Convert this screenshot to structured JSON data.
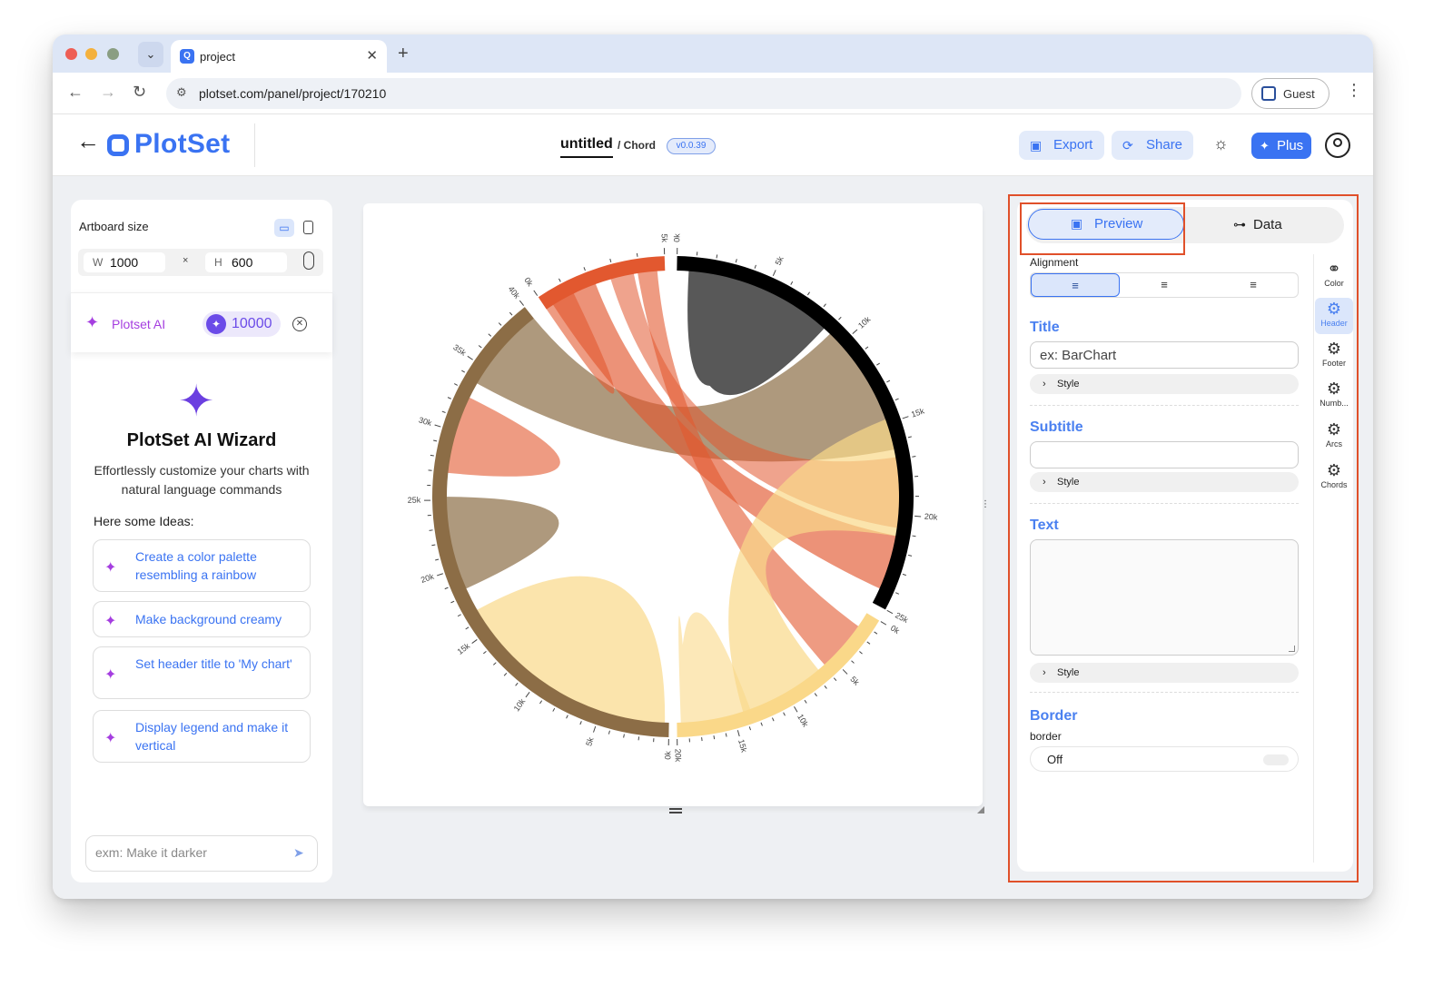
{
  "browser": {
    "tab_title": "project",
    "tab_icon": "plotset-favicon",
    "url": "plotset.com/panel/project/170210",
    "profile_label": "Guest"
  },
  "header": {
    "logo_text": "PlotSet",
    "project_name": "untitled",
    "project_type": "/ Chord",
    "version": "v0.0.39",
    "export_label": "Export",
    "share_label": "Share",
    "plus_label": "Plus"
  },
  "artboard": {
    "title": "Artboard size",
    "w_key": "W",
    "width": "1000",
    "separator": "×",
    "h_key": "H",
    "height": "600"
  },
  "ai": {
    "label": "Plotset AI",
    "credits": "10000",
    "wizard_title": "PlotSet AI Wizard",
    "wizard_subtitle": "Effortlessly customize your charts with natural language commands",
    "ideas_label": "Here some Ideas:",
    "ideas": [
      "Create a color palette resembling a rainbow",
      "Make background creamy",
      "Set header title to 'My chart'",
      "Display legend and make it vertical"
    ],
    "prompt_placeholder": "exm: Make it darker"
  },
  "chart_data": {
    "type": "chord",
    "colors": {
      "black_group": "#000000",
      "brown_group": "#8c6d46",
      "red_group": "#e2582f",
      "yellow_group": "#fad889"
    },
    "groups": [
      {
        "color": "#000000",
        "ticks": [
          "0k",
          "5k",
          "10k",
          "15k",
          "20k",
          "25k"
        ]
      },
      {
        "color": "#fad889",
        "ticks": [
          "0k",
          "5k",
          "10k",
          "15k",
          "20k"
        ]
      },
      {
        "color": "#8c6d46",
        "ticks": [
          "0k",
          "5k",
          "10k",
          "15k",
          "20k",
          "25k",
          "30k",
          "35k",
          "40k"
        ]
      },
      {
        "color": "#e2582f",
        "ticks": [
          "0k",
          "5k"
        ]
      }
    ]
  },
  "panel": {
    "tab_preview": "Preview",
    "tab_data": "Data",
    "alignment_label": "Alignment",
    "align_options": [
      "≡",
      "≡",
      "≡"
    ],
    "title_label": "Title",
    "title_placeholder": "ex: BarChart",
    "subtitle_label": "Subtitle",
    "text_label": "Text",
    "style_label": "Style",
    "border_label": "Border",
    "border_sub": "border",
    "border_value": "Off",
    "side_tabs": [
      "Color",
      "Header",
      "Footer",
      "Numb...",
      "Arcs",
      "Chords"
    ]
  }
}
